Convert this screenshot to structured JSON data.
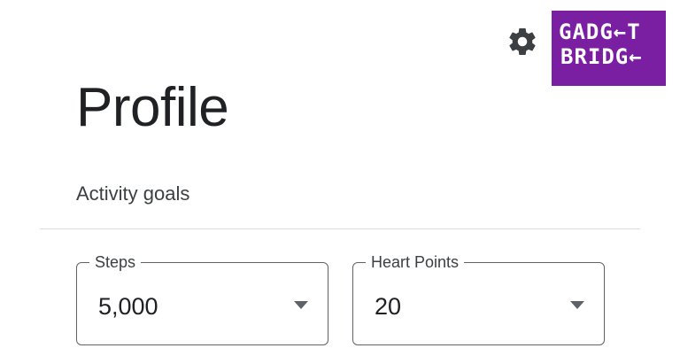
{
  "header": {
    "settings_icon": "gear-icon",
    "logo": {
      "line1": "GADG←T",
      "line2": "BRIDG←"
    }
  },
  "page": {
    "title": "Profile",
    "section_label": "Activity goals"
  },
  "goals": {
    "steps": {
      "label": "Steps",
      "value": "5,000"
    },
    "heart_points": {
      "label": "Heart Points",
      "value": "20"
    }
  },
  "colors": {
    "logo_background": "#7b1fa2",
    "field_border": "#5f6368",
    "divider": "#dadce0"
  }
}
